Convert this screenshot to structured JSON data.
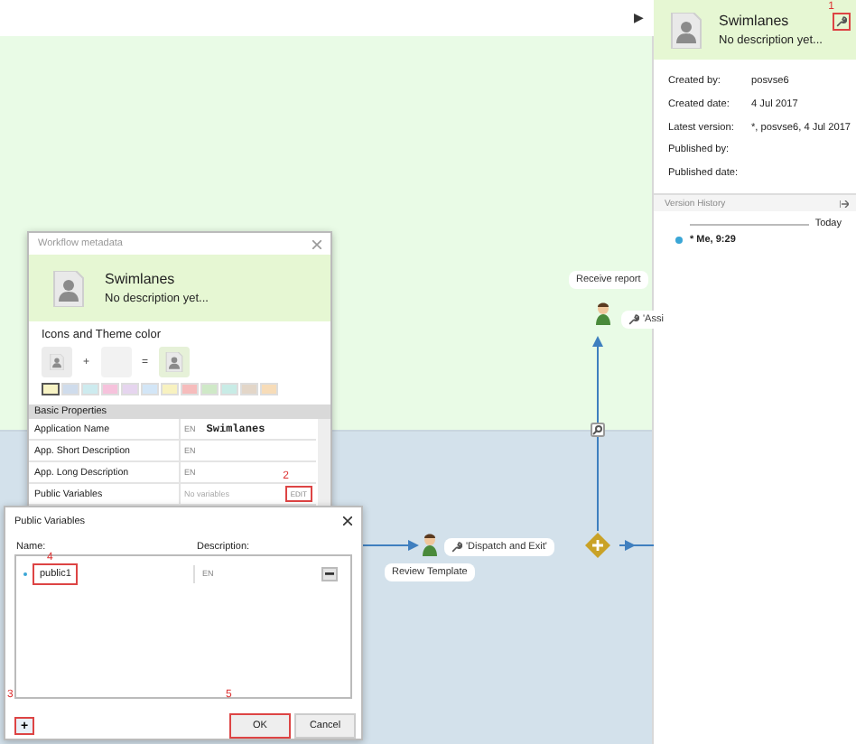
{
  "toolbar": {
    "run_glyph": "▶"
  },
  "info_panel": {
    "title": "Swimlanes",
    "description": "No description yet...",
    "callout": "1",
    "properties": [
      {
        "label": "Created by:",
        "value": "posvse6"
      },
      {
        "label": "Created date:",
        "value": "4 Jul 2017"
      },
      {
        "label": "Latest version:",
        "value": "*, posvse6, 4 Jul 2017"
      },
      {
        "label": "Published by:"
      },
      {
        "label": "Published date:"
      }
    ],
    "version_history": {
      "title": "Version History",
      "group": "Today",
      "entries": [
        {
          "label": "* Me, 9:29",
          "color": "#3aa6d6"
        }
      ]
    }
  },
  "diagram": {
    "nodes": [
      {
        "label": "Receive report",
        "action": "'Assi"
      },
      {
        "label": "Review Template",
        "action": "'Dispatch and Exit'"
      }
    ]
  },
  "metadata_dialog": {
    "title": "Workflow metadata",
    "name": "Swimlanes",
    "description": "No description yet...",
    "icons_label": "Icons and Theme color",
    "plus": "+",
    "equals": "=",
    "swatches": [
      {
        "color": "#f7f3c4",
        "selected": true
      },
      {
        "color": "#cfdcec",
        "selected": false
      },
      {
        "color": "#cdebef",
        "selected": false
      },
      {
        "color": "#f6c2dc",
        "selected": false
      },
      {
        "color": "#e6d5ef",
        "selected": false
      },
      {
        "color": "#d3e6f7",
        "selected": false
      },
      {
        "color": "#f8f2c0",
        "selected": false
      },
      {
        "color": "#f6bcbc",
        "selected": false
      },
      {
        "color": "#cfe9c7",
        "selected": false
      },
      {
        "color": "#c8ece6",
        "selected": false
      },
      {
        "color": "#e3d6c8",
        "selected": false
      },
      {
        "color": "#f7dcb8",
        "selected": false
      }
    ],
    "section": "Basic Properties",
    "rows": [
      {
        "label": "Application Name",
        "lang": "EN",
        "value": "Swimlanes"
      },
      {
        "label": "App. Short Description",
        "lang": "EN"
      },
      {
        "label": "App. Long Description",
        "lang": "EN"
      },
      {
        "label": "Public Variables",
        "placeholder": "No variables",
        "button": "EDIT",
        "callout": "2"
      }
    ]
  },
  "public_variables_dialog": {
    "title": "Public Variables",
    "columns": [
      "Name:",
      "Description:"
    ],
    "variables": [
      {
        "name": "public1",
        "lang": "EN",
        "callout": "4"
      }
    ],
    "add_button": {
      "label": "+",
      "callout": "3"
    },
    "buttons": [
      {
        "label": "OK",
        "callout": "5"
      },
      {
        "label": "Cancel"
      }
    ]
  }
}
